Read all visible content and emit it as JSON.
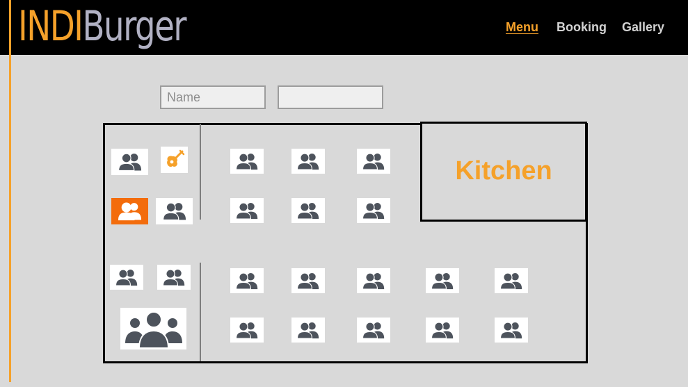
{
  "header": {
    "logo_part1": "INDI",
    "logo_part2": "Burger",
    "nav": [
      {
        "label": "Menu",
        "active": true
      },
      {
        "label": "Booking",
        "active": false
      },
      {
        "label": "Gallery",
        "active": false
      }
    ]
  },
  "form": {
    "name_placeholder": "Name",
    "second_value": ""
  },
  "floorplan": {
    "kitchen_label": "Kitchen",
    "stage_icon": "guitar-icon",
    "table_icon": "people-group-icon",
    "selected_table_color": "#f36c0c",
    "accent_color": "#f5a12a"
  }
}
